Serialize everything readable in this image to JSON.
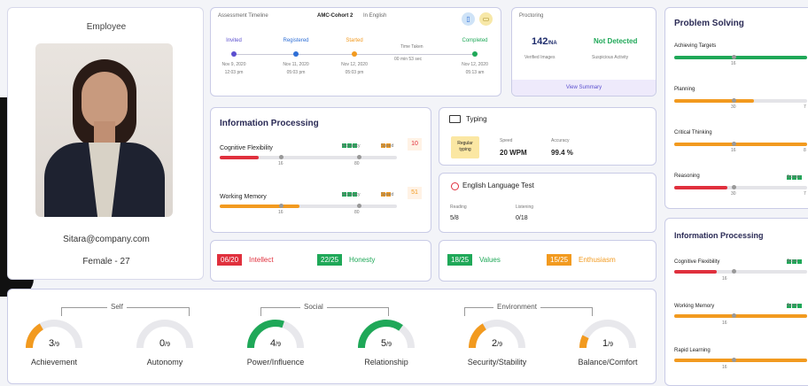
{
  "employee": {
    "heading": "Employee",
    "email": "Sitara@company.com",
    "gender_age": "Female - 27"
  },
  "timeline": {
    "title": "Assessment Timeline",
    "cohort": "AMC-Cohort 2",
    "language": "In English",
    "steps": [
      {
        "label": "Invited",
        "date": "Nov 9, 2020",
        "time": "12:03 pm",
        "color": "#5b4fcf"
      },
      {
        "label": "Registered",
        "date": "Nov 11, 2020",
        "time": "05:03 pm",
        "color": "#2f6fd6"
      },
      {
        "label": "Started",
        "date": "Nov 12, 2020",
        "time": "05:03 pm",
        "color": "#f29a1f"
      },
      {
        "label": "Completed",
        "date": "Nov 12, 2020",
        "time": "05:13 am",
        "color": "#1fa858"
      }
    ],
    "time_taken_label": "Time Taken",
    "time_taken_value": "00 min 53 sec"
  },
  "proctoring": {
    "title": "Proctoring",
    "images_value": "142",
    "images_unit": "/NA",
    "images_label": "Verified Images",
    "status_value": "Not Detected",
    "status_label": "Suspicious Activity",
    "link": "View Summary"
  },
  "info_processing": {
    "title": "Information Processing",
    "rows": [
      {
        "label": "Cognitive Flexibility",
        "accuracy_label": "Accuracy",
        "speed_label": "Speed",
        "score": "10",
        "score_color": "#e0303d",
        "fill": 0.22,
        "fill_color": "#e0303d",
        "t1": "16",
        "t2": "80"
      },
      {
        "label": "Working Memory",
        "accuracy_label": "Accuracy",
        "speed_label": "Speed",
        "score": "51",
        "score_color": "#f29a1f",
        "fill": 0.45,
        "fill_color": "#f29a1f",
        "t1": "16",
        "t2": "80"
      }
    ]
  },
  "typing": {
    "title": "Typing",
    "badge": "Regular typing",
    "speed_label": "Speed",
    "speed_value": "20 WPM",
    "accuracy_label": "Accuracy",
    "accuracy_value": "99.4 %"
  },
  "english": {
    "title": "English Language Test",
    "reading_label": "Reading",
    "reading_value": "5/8",
    "listening_label": "Listening",
    "listening_value": "0/18"
  },
  "traits": [
    {
      "value": "06/20",
      "label": "Intellect",
      "color": "#e0303d"
    },
    {
      "value": "22/25",
      "label": "Honesty",
      "color": "#1fa858"
    },
    {
      "value": "18/25",
      "label": "Values",
      "color": "#1fa858"
    },
    {
      "value": "15/25",
      "label": "Enthusiasm",
      "color": "#f29a1f"
    }
  ],
  "motivators": {
    "group_self": "Self",
    "group_social": "Social",
    "group_env": "Environment",
    "items": [
      {
        "value": "3",
        "max": "/9",
        "label": "Achievement",
        "fraction": 0.33,
        "color": "#f29a1f"
      },
      {
        "value": "0",
        "max": "/9",
        "label": "Autonomy",
        "fraction": 0,
        "color": "#f29a1f"
      },
      {
        "value": "4",
        "max": "/9",
        "label": "Power/Influence",
        "fraction": 0.6,
        "color": "#1fa858"
      },
      {
        "value": "5",
        "max": "/9",
        "label": "Relationship",
        "fraction": 0.7,
        "color": "#1fa858"
      },
      {
        "value": "2",
        "max": "/9",
        "label": "Security/Stability",
        "fraction": 0.33,
        "color": "#f29a1f"
      },
      {
        "value": "1",
        "max": "/9",
        "label": "Balance/Comfort",
        "fraction": 0.15,
        "color": "#f29a1f"
      }
    ]
  },
  "problem_solving": {
    "title": "Problem Solving",
    "accuracy_label": "Accura",
    "rows": [
      {
        "label": "Achieving Targets",
        "fill": 1.0,
        "color": "#1fa858",
        "t1": "16",
        "t2": ""
      },
      {
        "label": "Planning",
        "fill": 0.6,
        "color": "#f29a1f",
        "t1": "30",
        "t2": "7"
      },
      {
        "label": "Critical Thinking",
        "fill": 1.0,
        "color": "#f29a1f",
        "t1": "16",
        "t2": "8"
      },
      {
        "label": "Reasoning",
        "fill": 0.4,
        "color": "#e0303d",
        "t1": "30",
        "t2": "7"
      }
    ]
  },
  "info_processing_right": {
    "title": "Information Processing",
    "accuracy_label": "Accur",
    "rows": [
      {
        "label": "Cognitive Flexibility",
        "fill": 0.32,
        "color": "#e0303d",
        "t1": "16"
      },
      {
        "label": "Working Memory",
        "fill": 1.0,
        "color": "#f29a1f",
        "t1": "16"
      },
      {
        "label": "Rapid Learning",
        "fill": 1.0,
        "color": "#f29a1f",
        "t1": "16"
      }
    ]
  }
}
